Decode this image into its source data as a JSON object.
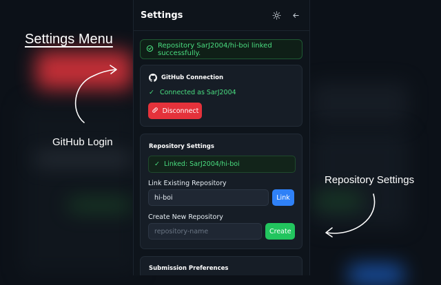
{
  "annotations": {
    "settings_menu": "Settings Menu",
    "github_login": "GitHub Login",
    "repository_settings": "Repository Settings"
  },
  "header": {
    "title": "Settings",
    "theme_icon": "sun-icon",
    "back_icon": "arrow-left-icon"
  },
  "alert": {
    "icon": "check-circle-icon",
    "text": "Repository SarJ2004/hi-boi linked successfully."
  },
  "github_connection": {
    "title": "GitHub Connection",
    "icon": "github-icon",
    "status": "Connected as SarJ2004",
    "disconnect_label": "Disconnect"
  },
  "repository_settings": {
    "title": "Repository Settings",
    "linked_text": "Linked: SarJ2004/hi-boi",
    "link_existing_label": "Link Existing Repository",
    "link_input_value": "hi-boi",
    "link_button": "Link",
    "create_new_label": "Create New Repository",
    "create_input_placeholder": "repository-name",
    "create_button": "Create"
  },
  "submission_preferences": {
    "title": "Submission Preferences"
  },
  "colors": {
    "success": "#4ade80",
    "danger": "#e5323b",
    "primary": "#2f81f7",
    "create": "#22c55e",
    "panel_bg": "#0e141b"
  }
}
